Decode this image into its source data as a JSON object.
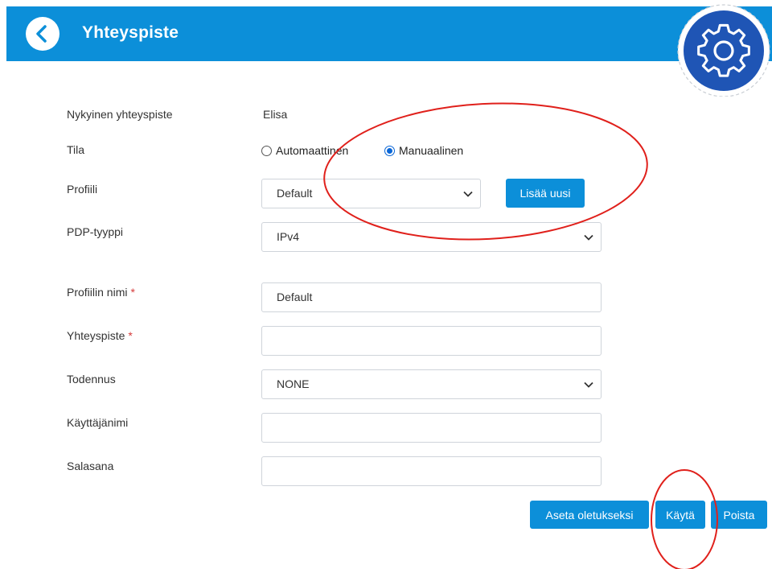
{
  "header": {
    "title": "Yhteyspiste",
    "back_icon": "chevron-left-icon",
    "settings_icon": "gear-icon",
    "color": "#0c8fd9"
  },
  "form": {
    "current_apn_label": "Nykyinen yhteyspiste",
    "current_apn_value": "Elisa",
    "mode_label": "Tila",
    "mode_options": [
      "Automaattinen",
      "Manuaalinen"
    ],
    "mode_selected": "Manuaalinen",
    "profile_label": "Profiili",
    "profile_value": "Default",
    "add_new_label": "Lisää uusi",
    "pdp_label": "PDP-tyyppi",
    "pdp_value": "IPv4",
    "profile_name_label": "Profiilin nimi",
    "profile_name_value": "Default",
    "apn_label": "Yhteyspiste",
    "apn_value": "",
    "auth_label": "Todennus",
    "auth_value": "NONE",
    "username_label": "Käyttäjänimi",
    "username_value": "",
    "password_label": "Salasana",
    "password_value": "",
    "required_mark": "*"
  },
  "actions": {
    "set_default": "Aseta oletukseksi",
    "apply": "Käytä",
    "delete": "Poista"
  },
  "annotation_color": "#e0201b"
}
